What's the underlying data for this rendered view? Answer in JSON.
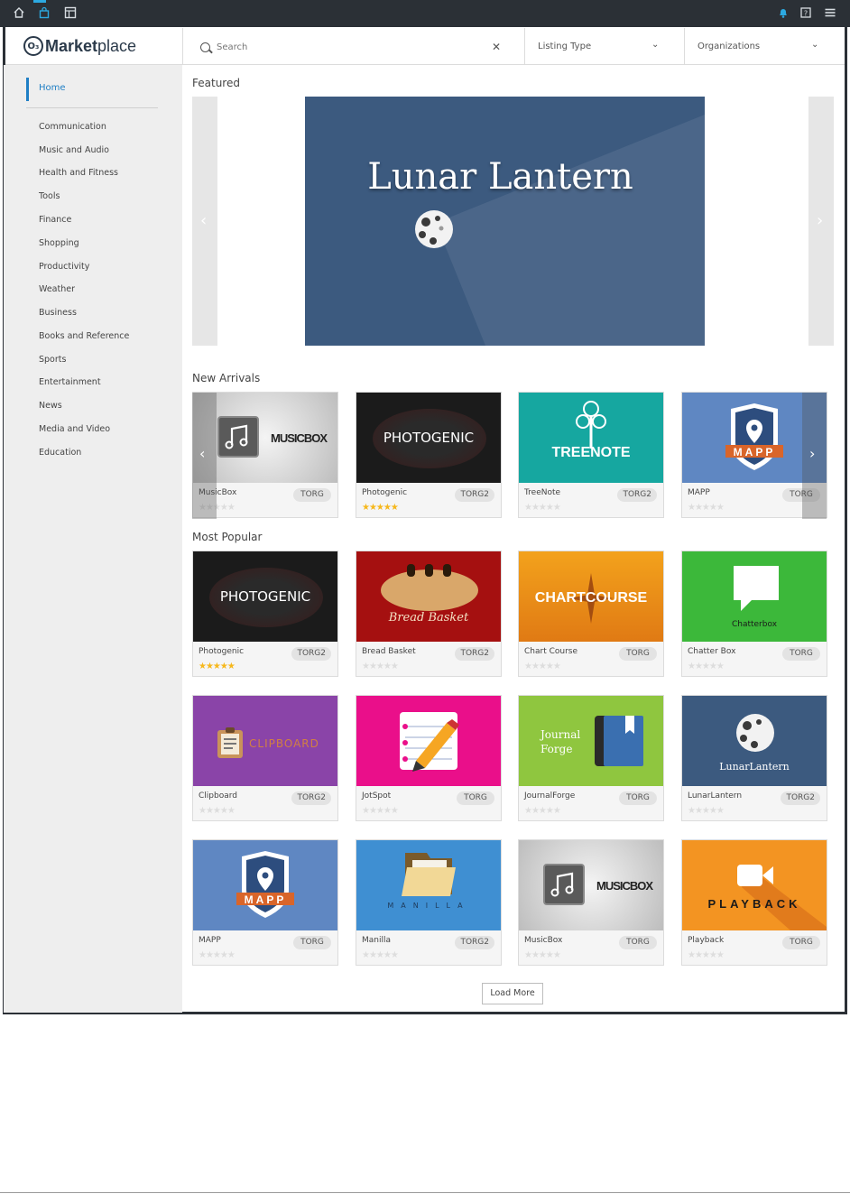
{
  "topbar": {
    "icons": [
      "home-icon",
      "shopping-bag-icon",
      "dashboard-icon",
      "bell-icon",
      "help-icon",
      "hamburger-menu-icon"
    ],
    "accent": "#2ca9e1"
  },
  "header": {
    "logo_badge": "O₃",
    "logo_bold": "Market",
    "logo_light": "place",
    "search": {
      "placeholder": "Search",
      "value": ""
    },
    "listing_type": "Listing Type",
    "organizations": "Organizations"
  },
  "sidebar": {
    "home": "Home",
    "categories": [
      "Communication",
      "Music and Audio",
      "Health and Fitness",
      "Tools",
      "Finance",
      "Shopping",
      "Productivity",
      "Weather",
      "Business",
      "Books and Reference",
      "Sports",
      "Entertainment",
      "News",
      "Media and Video",
      "Education"
    ]
  },
  "featured": {
    "title": "Featured",
    "banner_title": "Lunar Lantern",
    "banner_color": "#3c5a7f"
  },
  "new_arrivals": {
    "title": "New Arrivals",
    "items": [
      {
        "name": "MusicBox",
        "org": "TORG",
        "rating": 0,
        "tile_text": "MUSICBOX"
      },
      {
        "name": "Photogenic",
        "org": "TORG2",
        "rating": 5,
        "tile_text": "PHOTOGENIC"
      },
      {
        "name": "TreeNote",
        "org": "TORG2",
        "rating": 0,
        "tile_text": "TREENOTE"
      },
      {
        "name": "MAPP",
        "org": "TORG",
        "rating": 0,
        "tile_text": "MAPP"
      }
    ]
  },
  "most_popular": {
    "title": "Most Popular",
    "items": [
      {
        "name": "Photogenic",
        "org": "TORG2",
        "rating": 5,
        "tile_text": "PHOTOGENIC"
      },
      {
        "name": "Bread Basket",
        "org": "TORG2",
        "rating": 0,
        "tile_text": "Bread Basket"
      },
      {
        "name": "Chart Course",
        "org": "TORG",
        "rating": 0,
        "tile_text": "CHARTCOURSE"
      },
      {
        "name": "Chatter Box",
        "org": "TORG",
        "rating": 0,
        "tile_text": "Chatterbox"
      },
      {
        "name": "Clipboard",
        "org": "TORG2",
        "rating": 0,
        "tile_text": "CLIPBOARD"
      },
      {
        "name": "JotSpot",
        "org": "TORG",
        "rating": 0,
        "tile_text": ""
      },
      {
        "name": "JournalForge",
        "org": "TORG",
        "rating": 0,
        "tile_text": "Journal Forge"
      },
      {
        "name": "LunarLantern",
        "org": "TORG2",
        "rating": 0,
        "tile_text": "LunarLantern"
      },
      {
        "name": "MAPP",
        "org": "TORG",
        "rating": 0,
        "tile_text": "MAPP"
      },
      {
        "name": "Manilla",
        "org": "TORG2",
        "rating": 0,
        "tile_text": "MANILLA"
      },
      {
        "name": "MusicBox",
        "org": "TORG",
        "rating": 0,
        "tile_text": "MUSICBOX"
      },
      {
        "name": "Playback",
        "org": "TORG",
        "rating": 0,
        "tile_text": "PLAYBACK"
      }
    ]
  },
  "load_more": "Load More"
}
